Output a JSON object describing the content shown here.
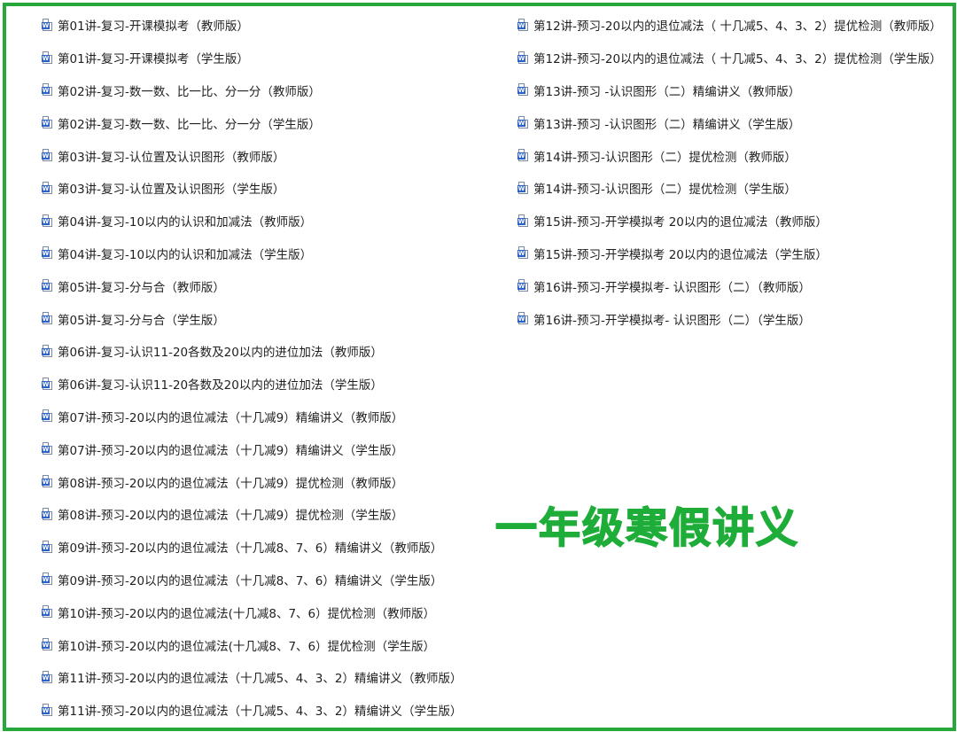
{
  "theme": {
    "border_color": "#26a83a",
    "headline_color": "#1fad3a",
    "icon_color": "#2b62c9"
  },
  "icon": {
    "name": "word-document-icon",
    "badge": "W"
  },
  "headline": "一年级寒假讲义",
  "files_left": [
    "第01讲-复习-开课模拟考（教师版）",
    "第01讲-复习-开课模拟考（学生版）",
    "第02讲-复习-数一数、比一比、分一分（教师版）",
    "第02讲-复习-数一数、比一比、分一分（学生版）",
    "第03讲-复习-认位置及认识图形（教师版）",
    "第03讲-复习-认位置及认识图形（学生版）",
    "第04讲-复习-10以内的认识和加减法（教师版）",
    "第04讲-复习-10以内的认识和加减法（学生版）",
    "第05讲-复习-分与合（教师版）",
    "第05讲-复习-分与合（学生版）",
    "第06讲-复习-认识11-20各数及20以内的进位加法（教师版）",
    "第06讲-复习-认识11-20各数及20以内的进位加法（学生版）",
    "第07讲-预习-20以内的退位减法（十几减9）精编讲义（教师版）",
    "第07讲-预习-20以内的退位减法（十几减9）精编讲义（学生版）",
    "第08讲-预习-20以内的退位减法（十几减9）提优检测（教师版）",
    "第08讲-预习-20以内的退位减法（十几减9）提优检测（学生版）",
    "第09讲-预习-20以内的退位减法（十几减8、7、6）精编讲义（教师版）",
    "第09讲-预习-20以内的退位减法（十几减8、7、6）精编讲义（学生版）",
    "第10讲-预习-20以内的退位减法(十几减8、7、6）提优检测（教师版）",
    "第10讲-预习-20以内的退位减法(十几减8、7、6）提优检测（学生版）",
    "第11讲-预习-20以内的退位减法（十几减5、4、3、2）精编讲义（教师版）",
    "第11讲-预习-20以内的退位减法（十几减5、4、3、2）精编讲义（学生版）"
  ],
  "files_right": [
    "第12讲-预习-20以内的退位减法（ 十几减5、4、3、2）提优检测（教师版）",
    "第12讲-预习-20以内的退位减法（ 十几减5、4、3、2）提优检测（学生版）",
    "第13讲-预习 -认识图形（二）精编讲义（教师版）",
    "第13讲-预习 -认识图形（二）精编讲义（学生版）",
    "第14讲-预习-认识图形（二）提优检测（教师版）",
    "第14讲-预习-认识图形（二）提优检测（学生版）",
    "第15讲-预习-开学模拟考 20以内的退位减法（教师版）",
    "第15讲-预习-开学模拟考 20以内的退位减法（学生版）",
    "第16讲-预习-开学模拟考- 认识图形（二）（教师版）",
    "第16讲-预习-开学模拟考- 认识图形（二）（学生版）"
  ]
}
